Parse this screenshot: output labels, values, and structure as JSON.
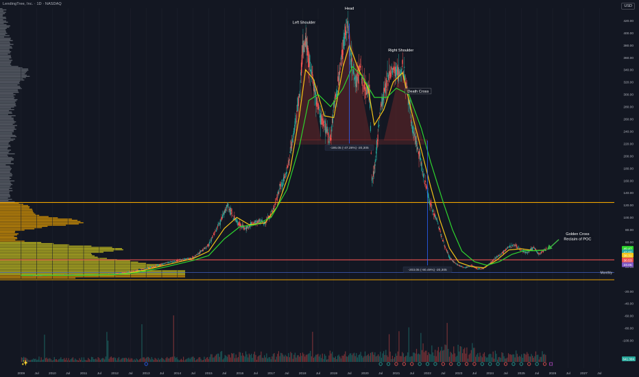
{
  "header": {
    "symbol": "LendingTree, Inc. · 1D · NASDAQ",
    "currency": "USD"
  },
  "colors": {
    "background": "#131722",
    "price_line": "#26a69a",
    "candle_up": "#26a69a",
    "candle_down": "#ef5350",
    "ma_fast": "#f5c518",
    "ma_slow": "#2ed52e",
    "profile_upper": "#9aa0a8",
    "profile_lower": "#f0a500",
    "profile_value_area": "#d8d020",
    "level_orange": "#f0a500",
    "level_red": "#ef5350",
    "level_blue": "#3f5fbf",
    "measure_blue": "#2962ff",
    "pattern_fill": "#7a2a2a",
    "annotation_arrow": "#3cb043"
  },
  "chart_data": {
    "type": "line",
    "title": "LendingTree, Inc. · 1D · NASDAQ",
    "x_axis": {
      "range": [
        2008.5,
        2027.8
      ],
      "tick_labels": [
        {
          "x": 2009.0,
          "label": "2009"
        },
        {
          "x": 2009.5,
          "label": "Jul"
        },
        {
          "x": 2010.0,
          "label": "2010"
        },
        {
          "x": 2010.5,
          "label": "Jul"
        },
        {
          "x": 2011.0,
          "label": "2011"
        },
        {
          "x": 2011.5,
          "label": "Jul"
        },
        {
          "x": 2012.0,
          "label": "2012"
        },
        {
          "x": 2012.5,
          "label": "Jul"
        },
        {
          "x": 2013.0,
          "label": "2013"
        },
        {
          "x": 2013.5,
          "label": "Jul"
        },
        {
          "x": 2014.0,
          "label": "2014"
        },
        {
          "x": 2014.5,
          "label": "Jul"
        },
        {
          "x": 2015.0,
          "label": "2015"
        },
        {
          "x": 2015.5,
          "label": "Jul"
        },
        {
          "x": 2016.0,
          "label": "2016"
        },
        {
          "x": 2016.5,
          "label": "Jul"
        },
        {
          "x": 2017.0,
          "label": "2017"
        },
        {
          "x": 2017.5,
          "label": "Jul"
        },
        {
          "x": 2018.0,
          "label": "2018"
        },
        {
          "x": 2018.5,
          "label": "Jul"
        },
        {
          "x": 2019.0,
          "label": "2019"
        },
        {
          "x": 2019.5,
          "label": "Jul"
        },
        {
          "x": 2020.0,
          "label": "2020"
        },
        {
          "x": 2020.5,
          "label": "Jul"
        },
        {
          "x": 2021.0,
          "label": "2021"
        },
        {
          "x": 2021.5,
          "label": "Jul"
        },
        {
          "x": 2022.0,
          "label": "2022"
        },
        {
          "x": 2022.5,
          "label": "Jul"
        },
        {
          "x": 2023.0,
          "label": "2023"
        },
        {
          "x": 2023.5,
          "label": "Jul"
        },
        {
          "x": 2024.0,
          "label": "2024"
        },
        {
          "x": 2024.5,
          "label": "Jul"
        },
        {
          "x": 2025.0,
          "label": "2025"
        },
        {
          "x": 2025.5,
          "label": "Jul"
        },
        {
          "x": 2026.0,
          "label": "2026"
        },
        {
          "x": 2026.5,
          "label": "Jul"
        },
        {
          "x": 2027.0,
          "label": "2027"
        },
        {
          "x": 2027.5,
          "label": "Jul"
        }
      ]
    },
    "y_axis": {
      "scale": "linear",
      "range": [
        -135,
        440
      ],
      "price_ticks": [
        420,
        400,
        380,
        360,
        340,
        320,
        300,
        280,
        260,
        240,
        220,
        200,
        180,
        160,
        140,
        120,
        100,
        80,
        60,
        40,
        20
      ],
      "volume_ticks": [
        -20,
        -40,
        -60,
        -80,
        -100
      ]
    },
    "series": [
      {
        "kind": "price",
        "style": "candles",
        "points": [
          [
            2009.0,
            6
          ],
          [
            2009.5,
            5
          ],
          [
            2010.0,
            6
          ],
          [
            2010.5,
            7
          ],
          [
            2011.0,
            6
          ],
          [
            2011.5,
            6
          ],
          [
            2012.0,
            8
          ],
          [
            2012.5,
            12
          ],
          [
            2013.0,
            17
          ],
          [
            2013.5,
            24
          ],
          [
            2014.0,
            30
          ],
          [
            2014.5,
            34
          ],
          [
            2015.0,
            55
          ],
          [
            2015.4,
            95
          ],
          [
            2015.6,
            120
          ],
          [
            2015.8,
            100
          ],
          [
            2016.0,
            88
          ],
          [
            2016.2,
            82
          ],
          [
            2016.4,
            90
          ],
          [
            2016.6,
            95
          ],
          [
            2016.8,
            90
          ],
          [
            2017.0,
            105
          ],
          [
            2017.3,
            150
          ],
          [
            2017.5,
            175
          ],
          [
            2017.7,
            230
          ],
          [
            2017.9,
            300
          ],
          [
            2018.0,
            370
          ],
          [
            2018.1,
            390
          ],
          [
            2018.25,
            350
          ],
          [
            2018.4,
            300
          ],
          [
            2018.6,
            260
          ],
          [
            2018.8,
            240
          ],
          [
            2018.9,
            225
          ],
          [
            2019.0,
            280
          ],
          [
            2019.15,
            320
          ],
          [
            2019.3,
            380
          ],
          [
            2019.45,
            415
          ],
          [
            2019.55,
            360
          ],
          [
            2019.7,
            320
          ],
          [
            2019.85,
            340
          ],
          [
            2020.0,
            310
          ],
          [
            2020.15,
            300
          ],
          [
            2020.22,
            155
          ],
          [
            2020.35,
            200
          ],
          [
            2020.5,
            280
          ],
          [
            2020.7,
            320
          ],
          [
            2020.85,
            335
          ],
          [
            2021.0,
            340
          ],
          [
            2021.1,
            330
          ],
          [
            2021.2,
            345
          ],
          [
            2021.35,
            310
          ],
          [
            2021.5,
            250
          ],
          [
            2021.6,
            230
          ],
          [
            2021.75,
            200
          ],
          [
            2021.9,
            160
          ],
          [
            2022.0,
            140
          ],
          [
            2022.1,
            120
          ],
          [
            2022.3,
            95
          ],
          [
            2022.5,
            60
          ],
          [
            2022.7,
            35
          ],
          [
            2022.9,
            25
          ],
          [
            2023.0,
            22
          ],
          [
            2023.2,
            18
          ],
          [
            2023.4,
            22
          ],
          [
            2023.6,
            16
          ],
          [
            2023.8,
            17
          ],
          [
            2024.0,
            25
          ],
          [
            2024.2,
            35
          ],
          [
            2024.4,
            42
          ],
          [
            2024.6,
            52
          ],
          [
            2024.8,
            55
          ],
          [
            2025.0,
            47
          ],
          [
            2025.2,
            42
          ],
          [
            2025.4,
            52
          ],
          [
            2025.55,
            40
          ],
          [
            2025.7,
            45
          ],
          [
            2025.8,
            49
          ]
        ]
      },
      {
        "kind": "ma_fast",
        "style": "line",
        "points": [
          [
            2009.0,
            6
          ],
          [
            2010.0,
            6
          ],
          [
            2011.0,
            6
          ],
          [
            2012.0,
            7
          ],
          [
            2012.5,
            10
          ],
          [
            2013.0,
            15
          ],
          [
            2013.5,
            21
          ],
          [
            2014.0,
            27
          ],
          [
            2014.5,
            33
          ],
          [
            2015.0,
            45
          ],
          [
            2015.5,
            82
          ],
          [
            2015.9,
            100
          ],
          [
            2016.3,
            88
          ],
          [
            2016.8,
            91
          ],
          [
            2017.2,
            118
          ],
          [
            2017.6,
            175
          ],
          [
            2017.9,
            265
          ],
          [
            2018.1,
            340
          ],
          [
            2018.35,
            325
          ],
          [
            2018.7,
            265
          ],
          [
            2019.0,
            262
          ],
          [
            2019.3,
            345
          ],
          [
            2019.5,
            380
          ],
          [
            2019.8,
            340
          ],
          [
            2020.1,
            310
          ],
          [
            2020.3,
            250
          ],
          [
            2020.6,
            275
          ],
          [
            2020.9,
            320
          ],
          [
            2021.2,
            335
          ],
          [
            2021.5,
            270
          ],
          [
            2021.8,
            210
          ],
          [
            2022.1,
            150
          ],
          [
            2022.4,
            95
          ],
          [
            2022.7,
            50
          ],
          [
            2023.0,
            27
          ],
          [
            2023.4,
            20
          ],
          [
            2023.8,
            18
          ],
          [
            2024.2,
            30
          ],
          [
            2024.6,
            47
          ],
          [
            2025.0,
            49
          ],
          [
            2025.4,
            46
          ],
          [
            2025.8,
            47
          ]
        ]
      },
      {
        "kind": "ma_slow",
        "style": "line",
        "points": [
          [
            2009.0,
            6
          ],
          [
            2010.0,
            6
          ],
          [
            2011.0,
            6
          ],
          [
            2012.0,
            7
          ],
          [
            2012.5,
            9
          ],
          [
            2013.0,
            13
          ],
          [
            2013.5,
            18
          ],
          [
            2014.0,
            24
          ],
          [
            2014.5,
            30
          ],
          [
            2015.0,
            38
          ],
          [
            2015.5,
            65
          ],
          [
            2016.0,
            85
          ],
          [
            2016.5,
            88
          ],
          [
            2017.0,
            100
          ],
          [
            2017.5,
            145
          ],
          [
            2017.9,
            215
          ],
          [
            2018.2,
            290
          ],
          [
            2018.5,
            300
          ],
          [
            2018.9,
            280
          ],
          [
            2019.3,
            310
          ],
          [
            2019.6,
            345
          ],
          [
            2019.9,
            330
          ],
          [
            2020.3,
            295
          ],
          [
            2020.7,
            295
          ],
          [
            2021.0,
            310
          ],
          [
            2021.4,
            300
          ],
          [
            2021.8,
            245
          ],
          [
            2022.1,
            190
          ],
          [
            2022.5,
            125
          ],
          [
            2022.8,
            80
          ],
          [
            2023.1,
            45
          ],
          [
            2023.5,
            28
          ],
          [
            2023.9,
            22
          ],
          [
            2024.3,
            28
          ],
          [
            2024.7,
            40
          ],
          [
            2025.1,
            46
          ],
          [
            2025.5,
            46
          ],
          [
            2025.8,
            47
          ]
        ]
      }
    ],
    "volume_profile": {
      "price_range": [
        0,
        440
      ],
      "bin_size": 2
    },
    "volume_bars": {
      "range": [
        2009.0,
        2025.8
      ]
    },
    "horizontal_levels": [
      {
        "price": 124.16,
        "label": "124.16",
        "color": "orange"
      },
      {
        "price": 31.0,
        "label": "",
        "color": "red"
      },
      {
        "price": 10.6,
        "label": "Monthly",
        "color": "blue"
      },
      {
        "price": -1.43,
        "label": "-1.43",
        "color": "orange"
      }
    ],
    "price_labels": [
      {
        "price": 49.47,
        "label": "49.47",
        "color": "#2ed52e"
      },
      {
        "price": 43.8,
        "label": "43.80",
        "color": "#26a69a"
      },
      {
        "price": 38.31,
        "label": "38.31",
        "color": "#f5c518"
      },
      {
        "price": 30.53,
        "label": "30.53",
        "color": "#ef5350"
      },
      {
        "price": 23.05,
        "label": "23.05",
        "color": "#7e57c2"
      }
    ],
    "volume_label": {
      "label": "641.36K",
      "color": "#26a69a"
    },
    "annotations": [
      {
        "text": "Left Shoulder",
        "x": 2018.05,
        "y": 415
      },
      {
        "text": "Head",
        "x": 2019.5,
        "y": 438
      },
      {
        "text": "Right Shoulder",
        "x": 2021.15,
        "y": 370
      },
      {
        "text": "Death Cross",
        "x": 2021.7,
        "y": 303
      },
      {
        "text": "Golden Cross",
        "x": 2026.8,
        "y": 71
      },
      {
        "text": "Reclaim of POC",
        "x": 2026.8,
        "y": 63
      }
    ],
    "measurements": [
      {
        "x": 2019.5,
        "from": 415,
        "to": 220,
        "label": "-195.05 (-47.28%) -20,305"
      },
      {
        "x": 2022.0,
        "from": 225,
        "to": 22,
        "label": "-203.05 (-90.49%) -20,305"
      }
    ],
    "head_and_shoulders": {
      "left_shoulder": {
        "x_start": 2017.7,
        "x_peak": 2018.1,
        "x_end": 2018.6,
        "peak": 360
      },
      "head": {
        "x_start": 2018.9,
        "x_peak": 2019.5,
        "x_end": 2020.2,
        "peak": 405
      },
      "right_shoulder": {
        "x_start": 2020.6,
        "x_peak": 2021.15,
        "x_end": 2021.85,
        "peak": 345
      },
      "neckline": 225
    }
  }
}
